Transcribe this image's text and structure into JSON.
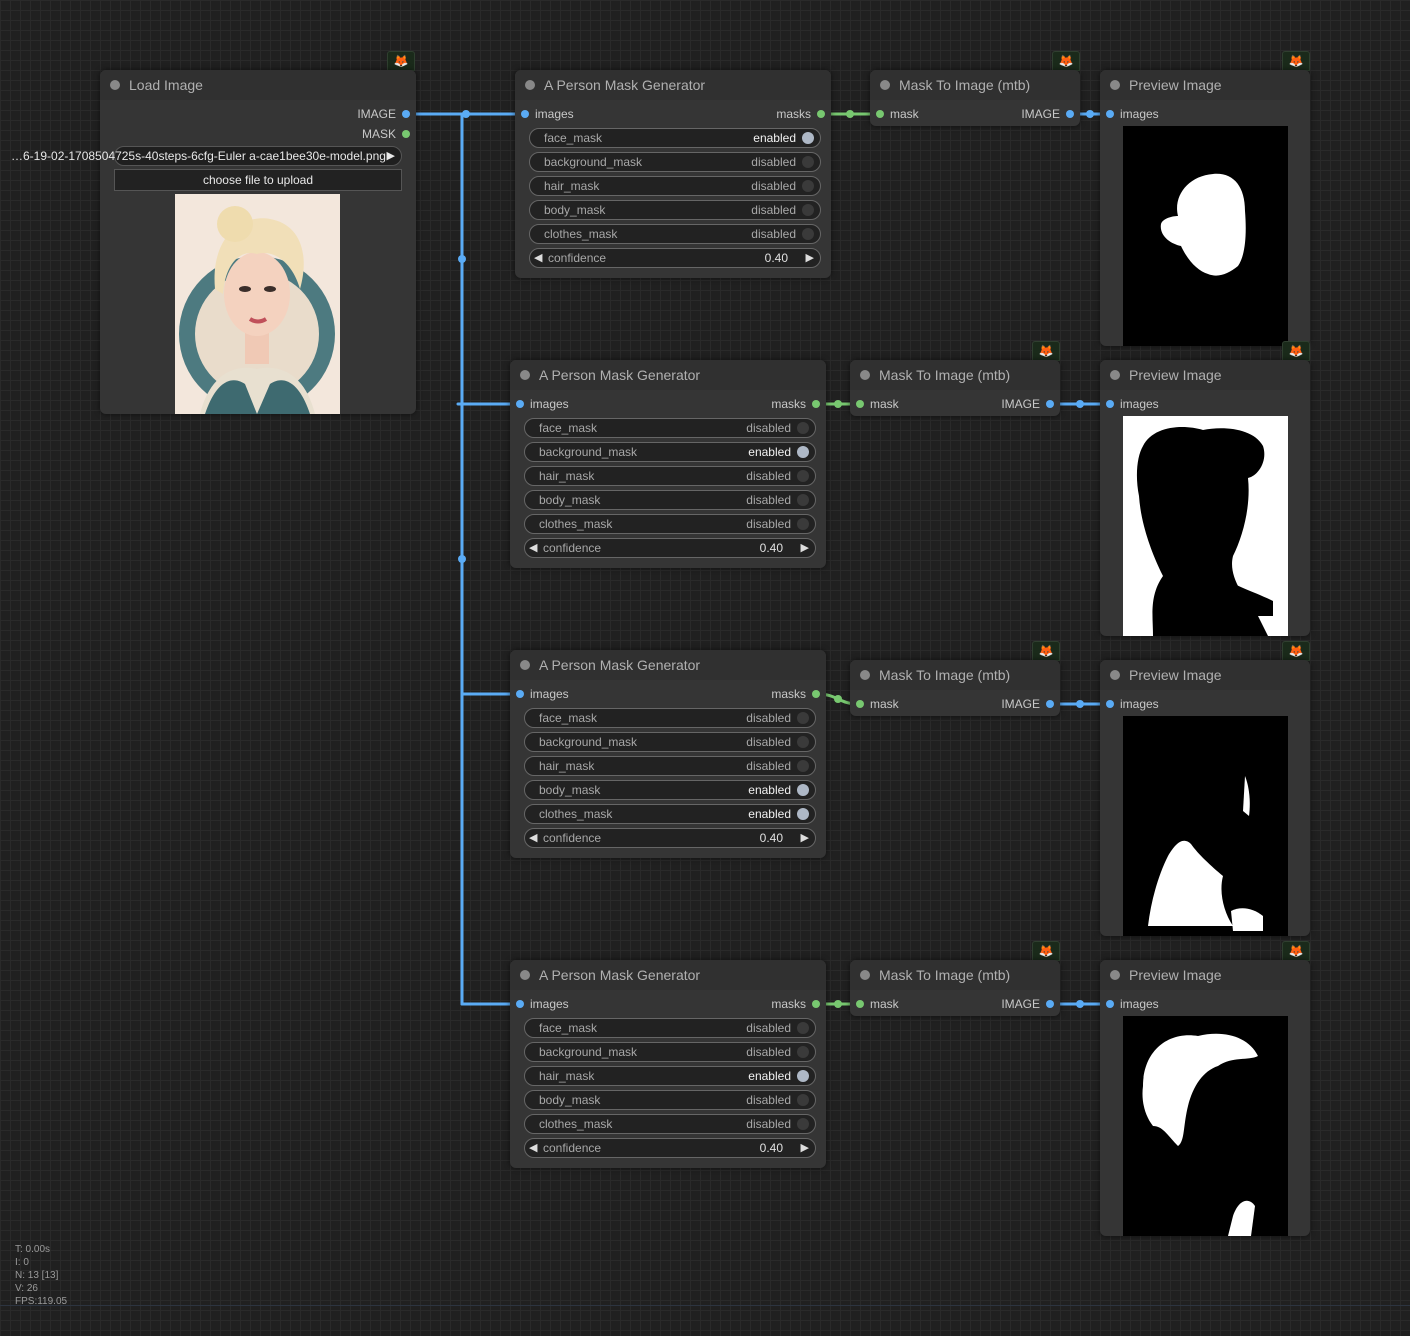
{
  "load_image": {
    "title": "Load Image",
    "outputs": [
      "IMAGE",
      "MASK"
    ],
    "filename": "…6-19-02-1708504725s-40steps-6cfg-Euler a-cae1bee30e-model.png",
    "upload_label": "choose file to upload"
  },
  "mask_generators": [
    {
      "title": "A Person Mask Generator",
      "input": "images",
      "output": "masks",
      "widgets": [
        {
          "label": "face_mask",
          "value": "enabled",
          "on": true
        },
        {
          "label": "background_mask",
          "value": "disabled",
          "on": false
        },
        {
          "label": "hair_mask",
          "value": "disabled",
          "on": false
        },
        {
          "label": "body_mask",
          "value": "disabled",
          "on": false
        },
        {
          "label": "clothes_mask",
          "value": "disabled",
          "on": false
        }
      ],
      "confidence": {
        "label": "confidence",
        "value": "0.40"
      }
    },
    {
      "title": "A Person Mask Generator",
      "input": "images",
      "output": "masks",
      "widgets": [
        {
          "label": "face_mask",
          "value": "disabled",
          "on": false
        },
        {
          "label": "background_mask",
          "value": "enabled",
          "on": true
        },
        {
          "label": "hair_mask",
          "value": "disabled",
          "on": false
        },
        {
          "label": "body_mask",
          "value": "disabled",
          "on": false
        },
        {
          "label": "clothes_mask",
          "value": "disabled",
          "on": false
        }
      ],
      "confidence": {
        "label": "confidence",
        "value": "0.40"
      }
    },
    {
      "title": "A Person Mask Generator",
      "input": "images",
      "output": "masks",
      "widgets": [
        {
          "label": "face_mask",
          "value": "disabled",
          "on": false
        },
        {
          "label": "background_mask",
          "value": "disabled",
          "on": false
        },
        {
          "label": "hair_mask",
          "value": "disabled",
          "on": false
        },
        {
          "label": "body_mask",
          "value": "enabled",
          "on": true
        },
        {
          "label": "clothes_mask",
          "value": "enabled",
          "on": true
        }
      ],
      "confidence": {
        "label": "confidence",
        "value": "0.40"
      }
    },
    {
      "title": "A Person Mask Generator",
      "input": "images",
      "output": "masks",
      "widgets": [
        {
          "label": "face_mask",
          "value": "disabled",
          "on": false
        },
        {
          "label": "background_mask",
          "value": "disabled",
          "on": false
        },
        {
          "label": "hair_mask",
          "value": "enabled",
          "on": true
        },
        {
          "label": "body_mask",
          "value": "disabled",
          "on": false
        },
        {
          "label": "clothes_mask",
          "value": "disabled",
          "on": false
        }
      ],
      "confidence": {
        "label": "confidence",
        "value": "0.40"
      }
    }
  ],
  "mask_to_image": {
    "title": "Mask To Image (mtb)",
    "input": "mask",
    "output": "IMAGE"
  },
  "preview": {
    "title": "Preview Image",
    "input": "images"
  },
  "stats": [
    "T: 0.00s",
    "I: 0",
    "N: 13 [13]",
    "V: 26",
    "FPS:119.05"
  ],
  "icons": {
    "badge": "fox-icon"
  },
  "colors": {
    "image_link": "#5aabf5",
    "mask_link": "#78c870",
    "background": "#202020",
    "node": "#353535"
  }
}
